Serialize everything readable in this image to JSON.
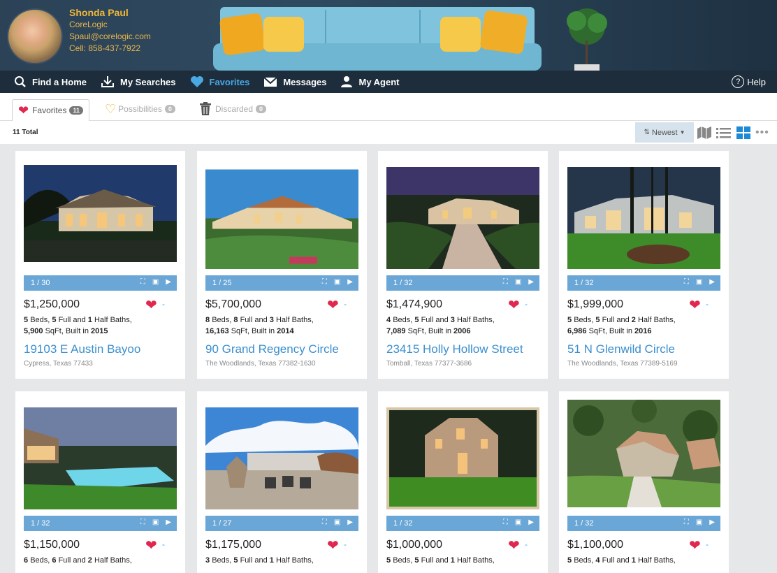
{
  "agent": {
    "name": "Shonda Paul",
    "company": "CoreLogic",
    "email": "Spaul@corelogic.com",
    "cell": "Cell: 858-437-7922"
  },
  "nav": {
    "items": [
      {
        "label": "Find a Home",
        "icon": "search-icon"
      },
      {
        "label": "My Searches",
        "icon": "download-icon"
      },
      {
        "label": "Favorites",
        "icon": "heart-icon",
        "active": true
      },
      {
        "label": "Messages",
        "icon": "envelope-icon"
      },
      {
        "label": "My Agent",
        "icon": "person-icon"
      }
    ],
    "help": "Help"
  },
  "tabs": [
    {
      "label": "Favorites",
      "count": "11",
      "icon": "heart-icon"
    },
    {
      "label": "Possibilities",
      "count": "0",
      "icon": "heart-outline-icon"
    },
    {
      "label": "Discarded",
      "count": "0",
      "icon": "trash-icon"
    }
  ],
  "summary": {
    "total": "11 Total"
  },
  "toolbar": {
    "sort_label": "Newest"
  },
  "listings": [
    {
      "photo_counter": "1 / 30",
      "price": "$1,250,000",
      "beds": "5",
      "full": "5",
      "half": "1",
      "sqft": "5,900",
      "built": "2015",
      "address": "19103 E Austin Bayoo",
      "city": "Cypress, Texas 77433"
    },
    {
      "photo_counter": "1 / 25",
      "price": "$5,700,000",
      "beds": "8",
      "full": "8",
      "half": "3",
      "sqft": "16,163",
      "built": "2014",
      "address": "90 Grand Regency Circle",
      "city": "The Woodlands, Texas 77382-1630"
    },
    {
      "photo_counter": "1 / 32",
      "price": "$1,474,900",
      "beds": "4",
      "full": "5",
      "half": "3",
      "sqft": "7,089",
      "built": "2006",
      "address": "23415 Holly Hollow Street",
      "city": "Tomball, Texas 77377-3686"
    },
    {
      "photo_counter": "1 / 32",
      "price": "$1,999,000",
      "beds": "5",
      "full": "5",
      "half": "2",
      "sqft": "6,986",
      "built": "2016",
      "address": "51 N Glenwild Circle",
      "city": "The Woodlands, Texas 77389-5169"
    },
    {
      "photo_counter": "1 / 32",
      "price": "$1,150,000",
      "beds": "6",
      "full": "6",
      "half": "2"
    },
    {
      "photo_counter": "1 / 27",
      "price": "$1,175,000",
      "beds": "3",
      "full": "5",
      "half": "1"
    },
    {
      "photo_counter": "1 / 32",
      "price": "$1,000,000",
      "beds": "5",
      "full": "5",
      "half": "1"
    },
    {
      "photo_counter": "1 / 32",
      "price": "$1,100,000",
      "beds": "5",
      "full": "4",
      "half": "1"
    }
  ],
  "labels": {
    "beds": "Beds,",
    "full": "Full and",
    "half": "Half Baths,",
    "sqft": "SqFt, Built in"
  },
  "colors": {
    "accent": "#3b8fcf",
    "heart": "#e0284f",
    "nav_bg": "#1d2d3b",
    "photobar": "#6aa6d6"
  }
}
